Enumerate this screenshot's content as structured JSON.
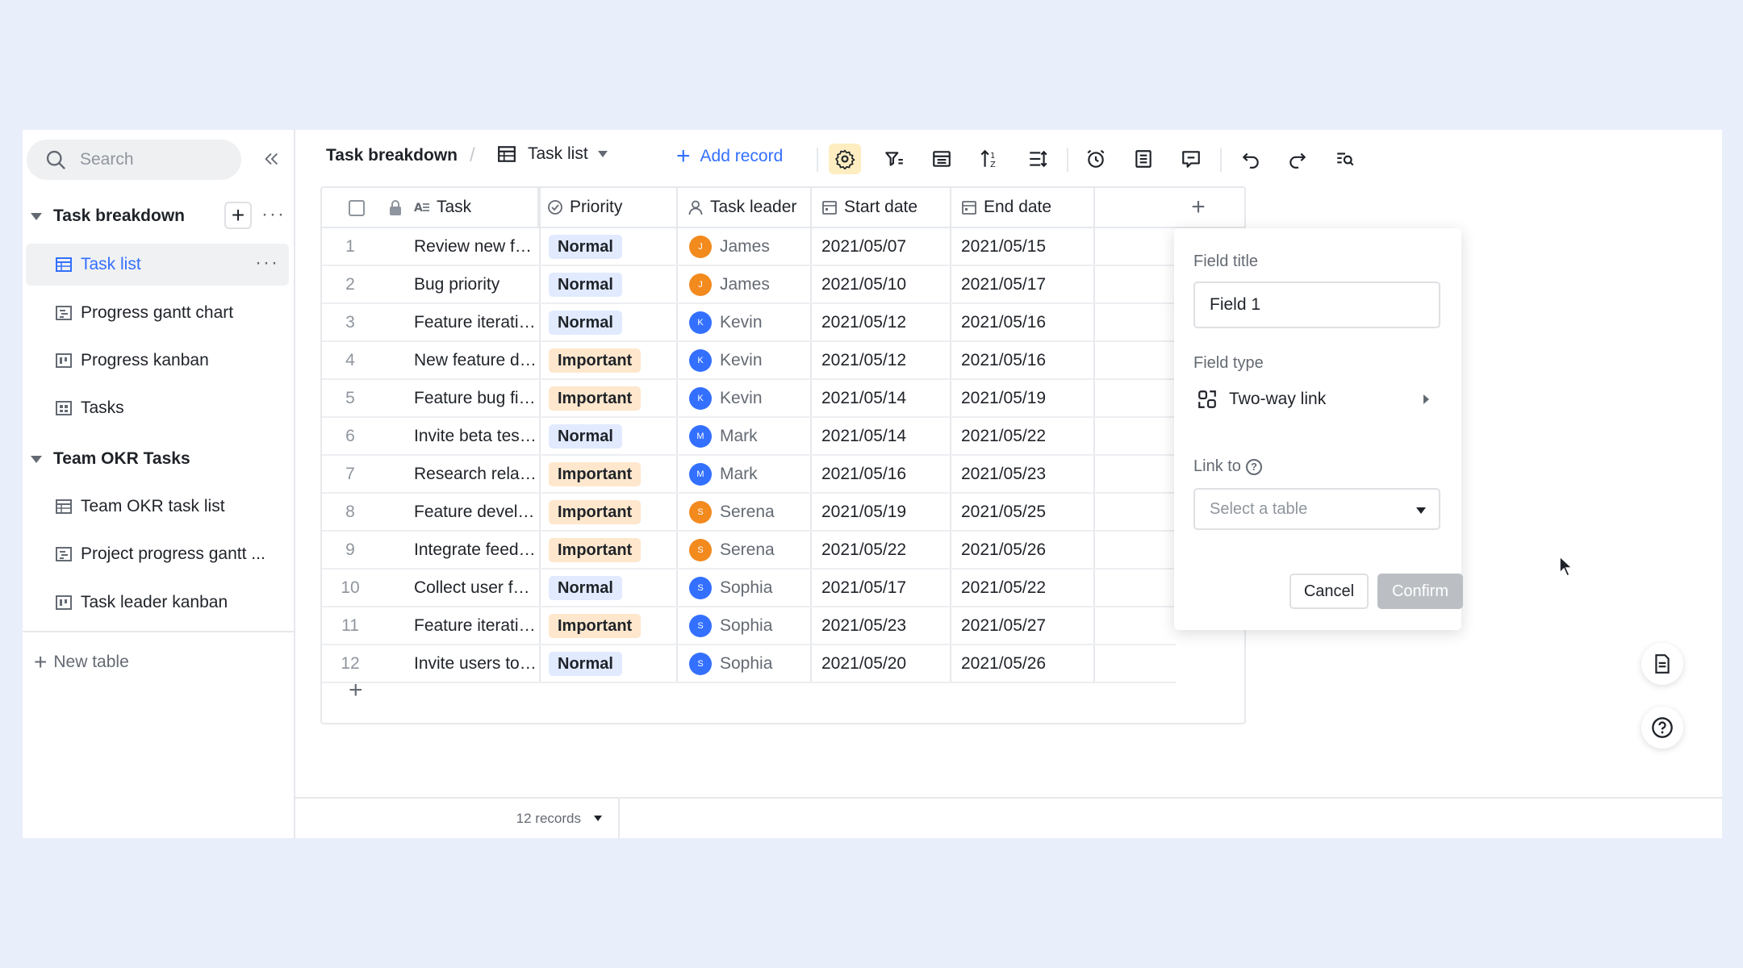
{
  "sidebar": {
    "search_placeholder": "Search",
    "groups": [
      {
        "title": "Task breakdown",
        "items": [
          {
            "label": "Task list",
            "icon": "grid-table-icon",
            "active": true
          },
          {
            "label": "Progress gantt chart",
            "icon": "gantt-icon"
          },
          {
            "label": "Progress kanban",
            "icon": "kanban-icon"
          },
          {
            "label": "Tasks",
            "icon": "gallery-icon"
          }
        ]
      },
      {
        "title": "Team OKR Tasks",
        "items": [
          {
            "label": "Team OKR task list",
            "icon": "grid-table-icon"
          },
          {
            "label": "Project progress gantt ...",
            "icon": "gantt-icon"
          },
          {
            "label": "Task leader kanban",
            "icon": "kanban-icon"
          }
        ]
      }
    ],
    "new_table_label": "New table"
  },
  "toolbar": {
    "breadcrumb": "Task breakdown",
    "separator": "/",
    "view_name": "Task list",
    "add_record_label": "Add record",
    "icons": [
      "settings-icon",
      "filter-icon",
      "group-icon",
      "sort-icon",
      "row-height-icon",
      "reminder-icon",
      "form-icon",
      "comment-icon",
      "undo-icon",
      "redo-icon",
      "find-icon"
    ]
  },
  "grid": {
    "columns": [
      "Task",
      "Priority",
      "Task leader",
      "Start date",
      "End date"
    ],
    "rows": [
      {
        "num": "1",
        "task": "Review new features",
        "priority": "Normal",
        "leader": "James",
        "initial": "J",
        "start": "2021/05/07",
        "end": "2021/05/15"
      },
      {
        "num": "2",
        "task": "Bug priority",
        "priority": "Normal",
        "leader": "James",
        "initial": "J",
        "start": "2021/05/10",
        "end": "2021/05/17"
      },
      {
        "num": "3",
        "task": "Feature iteration plan",
        "priority": "Normal",
        "leader": "Kevin",
        "initial": "K",
        "start": "2021/05/12",
        "end": "2021/05/16"
      },
      {
        "num": "4",
        "task": "New feature design",
        "priority": "Important",
        "leader": "Kevin",
        "initial": "K",
        "start": "2021/05/12",
        "end": "2021/05/16"
      },
      {
        "num": "5",
        "task": "Feature bug fixes",
        "priority": "Important",
        "leader": "Kevin",
        "initial": "K",
        "start": "2021/05/14",
        "end": "2021/05/19"
      },
      {
        "num": "6",
        "task": "Invite beta testers",
        "priority": "Normal",
        "leader": "Mark",
        "initial": "M",
        "start": "2021/05/14",
        "end": "2021/05/22"
      },
      {
        "num": "7",
        "task": "Research related produ...",
        "priority": "Important",
        "leader": "Mark",
        "initial": "M",
        "start": "2021/05/16",
        "end": "2021/05/23"
      },
      {
        "num": "8",
        "task": "Feature development",
        "priority": "Important",
        "leader": "Serena",
        "initial": "S",
        "start": "2021/05/19",
        "end": "2021/05/25"
      },
      {
        "num": "9",
        "task": "Integrate feedback dat...",
        "priority": "Important",
        "leader": "Serena",
        "initial": "S",
        "start": "2021/05/22",
        "end": "2021/05/26"
      },
      {
        "num": "10",
        "task": "Collect user feedback t...",
        "priority": "Normal",
        "leader": "Sophia",
        "initial": "S",
        "start": "2021/05/17",
        "end": "2021/05/22"
      },
      {
        "num": "11",
        "task": "Feature iteration priority",
        "priority": "Important",
        "leader": "Sophia",
        "initial": "S",
        "start": "2021/05/23",
        "end": "2021/05/27"
      },
      {
        "num": "12",
        "task": "Invite users to give fee...",
        "priority": "Normal",
        "leader": "Sophia",
        "initial": "S",
        "start": "2021/05/20",
        "end": "2021/05/26"
      }
    ],
    "avatar_colors": {
      "James": "#f28a1e",
      "Kevin": "#3370ff",
      "Mark": "#3370ff",
      "Serena": "#f28a1e",
      "Sophia": "#3370ff"
    }
  },
  "field_panel": {
    "title_label": "Field title",
    "title_value": "Field 1",
    "type_label": "Field type",
    "type_value": "Two-way link",
    "link_label": "Link to",
    "select_placeholder": "Select a table",
    "cancel_label": "Cancel",
    "confirm_label": "Confirm"
  },
  "footer": {
    "records_label": "12 records"
  },
  "colors": {
    "accent": "#3370ff",
    "background": "#e9eefb",
    "important_tag": "#fee7cd",
    "normal_tag": "#e1eaff"
  }
}
